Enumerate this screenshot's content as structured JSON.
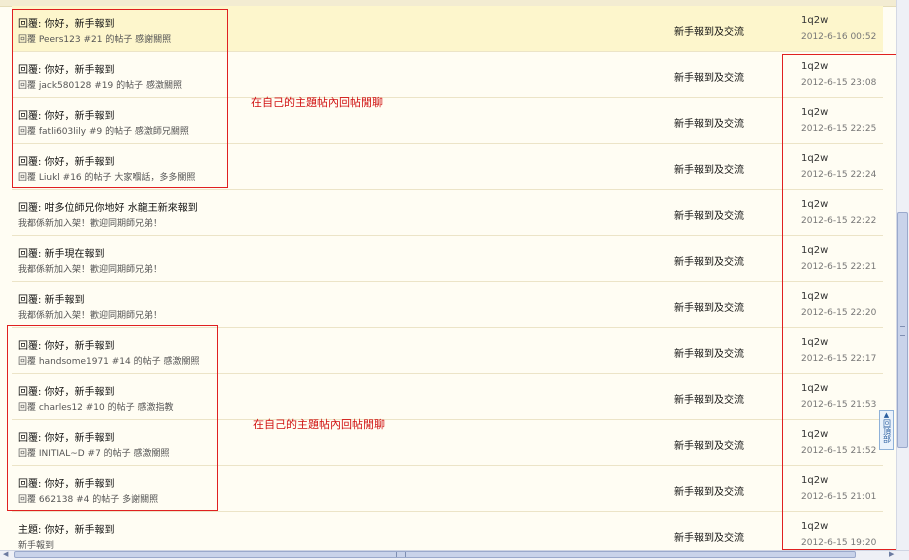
{
  "rows": [
    {
      "title": "回覆: 你好，新手報到",
      "sub": "回覆 Peers123 #21 的帖子 感謝關照",
      "forum": "新手報到及交流",
      "user": "1q2w",
      "time": "2012-6-16 00:52",
      "highlight": true
    },
    {
      "title": "回覆: 你好，新手報到",
      "sub": "回覆 jack580128 #19 的帖子 感激關照",
      "forum": "新手報到及交流",
      "user": "1q2w",
      "time": "2012-6-15 23:08"
    },
    {
      "title": "回覆: 你好，新手報到",
      "sub": "回覆 fatli603lily #9 的帖子 感激師兄關照",
      "forum": "新手報到及交流",
      "user": "1q2w",
      "time": "2012-6-15 22:25"
    },
    {
      "title": "回覆: 你好，新手報到",
      "sub": "回覆 Liukl #16 的帖子 大家嗰話，多多關照",
      "forum": "新手報到及交流",
      "user": "1q2w",
      "time": "2012-6-15 22:24"
    },
    {
      "title": "回覆: 咁多位師兄你地好 水龍王新來報到",
      "sub": "我都係新加入架！歡迎同期師兄弟！",
      "forum": "新手報到及交流",
      "user": "1q2w",
      "time": "2012-6-15 22:22"
    },
    {
      "title": "回覆: 新手現在報到",
      "sub": "我都係新加入架！歡迎同期師兄弟！",
      "forum": "新手報到及交流",
      "user": "1q2w",
      "time": "2012-6-15 22:21"
    },
    {
      "title": "回覆: 新手報到",
      "sub": "我都係新加入架！歡迎同期師兄弟！",
      "forum": "新手報到及交流",
      "user": "1q2w",
      "time": "2012-6-15 22:20"
    },
    {
      "title": "回覆: 你好，新手報到",
      "sub": "回覆 handsome1971 #14 的帖子 感激關照",
      "forum": "新手報到及交流",
      "user": "1q2w",
      "time": "2012-6-15 22:17"
    },
    {
      "title": "回覆: 你好，新手報到",
      "sub": "回覆 charles12 #10 的帖子 感激指教",
      "forum": "新手報到及交流",
      "user": "1q2w",
      "time": "2012-6-15 21:53"
    },
    {
      "title": "回覆: 你好，新手報到",
      "sub": "回覆 INITIAL~D #7 的帖子 感激關照",
      "forum": "新手報到及交流",
      "user": "1q2w",
      "time": "2012-6-15 21:52"
    },
    {
      "title": "回覆: 你好，新手報到",
      "sub": "回覆 662138 #4 的帖子 多謝關照",
      "forum": "新手報到及交流",
      "user": "1q2w",
      "time": "2012-6-15 21:01"
    },
    {
      "title": "主題: 你好，新手報到",
      "sub": "新手報到",
      "forum": "新手報到及交流",
      "user": "1q2w",
      "time": "2012-6-15 19:20"
    }
  ],
  "annotations": {
    "top": "在自己的主題帖內回帖閒聊",
    "bottom": "在自己的主題帖內回帖閒聊"
  },
  "back_to_top": {
    "label": "回頂部",
    "arrow": "▲"
  },
  "colors": {
    "annotation_red": "#e02020",
    "highlight_row": "#fdf6cc",
    "row_bg": "#fffdf3"
  },
  "icons": {
    "scroll_left": "◀",
    "scroll_right": "▶"
  }
}
